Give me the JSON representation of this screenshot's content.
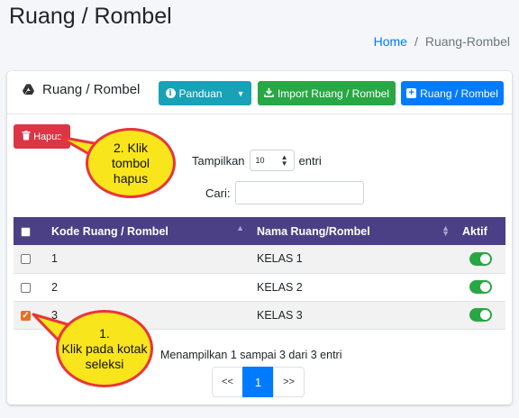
{
  "page": {
    "title": "Ruang / Rombel",
    "breadcrumb": {
      "home": "Home",
      "separator": "/",
      "current": "Ruang-Rombel"
    }
  },
  "card": {
    "title": "Ruang / Rombel",
    "title_icon": "google-drive-icon",
    "buttons": {
      "panduan": "Panduan",
      "import": "Import Ruang / Rombel",
      "add": "Ruang / Rombel"
    },
    "delete_button": "Hapus"
  },
  "datatable": {
    "length_label_before": "Tampilkan",
    "length_value": "10",
    "length_label_after": "entri",
    "search_label": "Cari:",
    "search_value": "",
    "columns": [
      "Kode Ruang / Rombel",
      "Nama Ruang/Rombel",
      "Aktif"
    ],
    "rows": [
      {
        "kode": "1",
        "nama": "KELAS 1",
        "checked": false,
        "aktif": true
      },
      {
        "kode": "2",
        "nama": "KELAS 2",
        "checked": false,
        "aktif": true
      },
      {
        "kode": "3",
        "nama": "KELAS 3",
        "checked": true,
        "aktif": true
      }
    ],
    "info": "Menampilkan 1 sampai 3 dari 3 entri",
    "pagination": {
      "prev": "<<",
      "current": "1",
      "next": ">>"
    }
  },
  "annotations": {
    "callout_delete": [
      "2. Klik",
      "tombol",
      "hapus"
    ],
    "callout_checkbox": [
      "1.",
      "Klik pada kotak",
      "seleksi"
    ]
  },
  "colors": {
    "header_bg": "#4b3f86",
    "info_btn": "#17a2b8",
    "success_btn": "#28a745",
    "primary_btn": "#007bff",
    "danger_btn": "#dc3545",
    "callout_fill": "#f9e51b",
    "callout_border": "#e8353a",
    "checkbox_checked": "#e86f24"
  }
}
